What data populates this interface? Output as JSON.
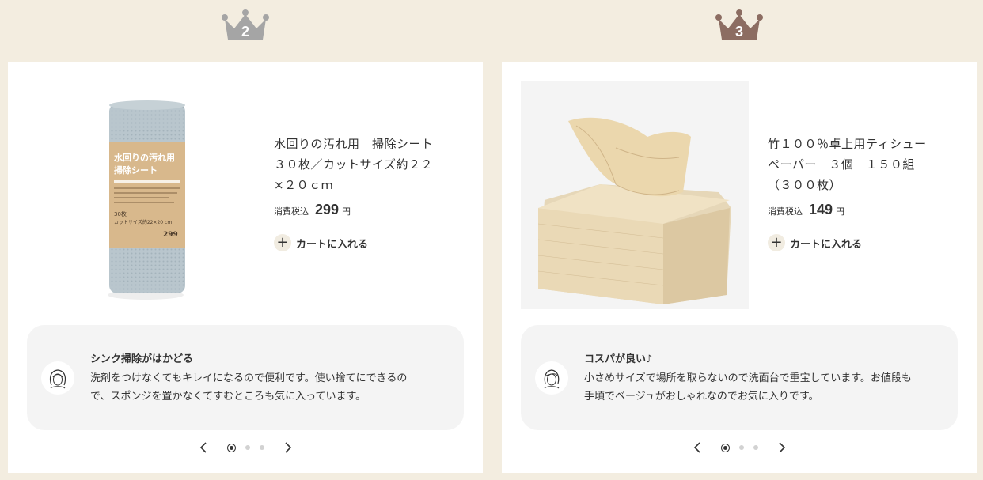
{
  "cards": [
    {
      "rank": "2",
      "crown_color": "#a5a5a5",
      "product": {
        "title_line1": "水回りの汚れ用　掃除シート",
        "title_line2": "３０枚／カットサイズ約２２",
        "title_line3": "×２０ｃｍ",
        "price_label": "消費税込",
        "price": "299",
        "price_unit": "円",
        "cart_label": "カートに入れる"
      },
      "package_text": {
        "line1": "水回りの汚れ用",
        "line2": "掃除シート",
        "count": "30枚",
        "size": "カットサイズ約22×20 cm",
        "price": "299"
      },
      "review": {
        "title": "シンク掃除がはかどる",
        "line1": "洗剤をつけなくてもキレイになるので便利です。使い捨てにできるの",
        "line2": "で、スポンジを置かなくてすむところも気に入っています。"
      },
      "pager": {
        "prev": "‹",
        "next": "›",
        "active_index": 0,
        "count": 3
      }
    },
    {
      "rank": "3",
      "crown_color": "#8c6d62",
      "product": {
        "title_line1": "竹１００％卓上用ティシュー",
        "title_line2": "ペーパー　３個　１５０組",
        "title_line3": "（３００枚）",
        "price_label": "消費税込",
        "price": "149",
        "price_unit": "円",
        "cart_label": "カートに入れる"
      },
      "review": {
        "title": "コスパが良い♪",
        "line1": "小さめサイズで場所を取らないので洗面台で重宝しています。お値段も",
        "line2": "手頃でベージュがおしゃれなのでお気に入りです。"
      },
      "pager": {
        "prev": "‹",
        "next": "›",
        "active_index": 0,
        "count": 3
      }
    }
  ]
}
